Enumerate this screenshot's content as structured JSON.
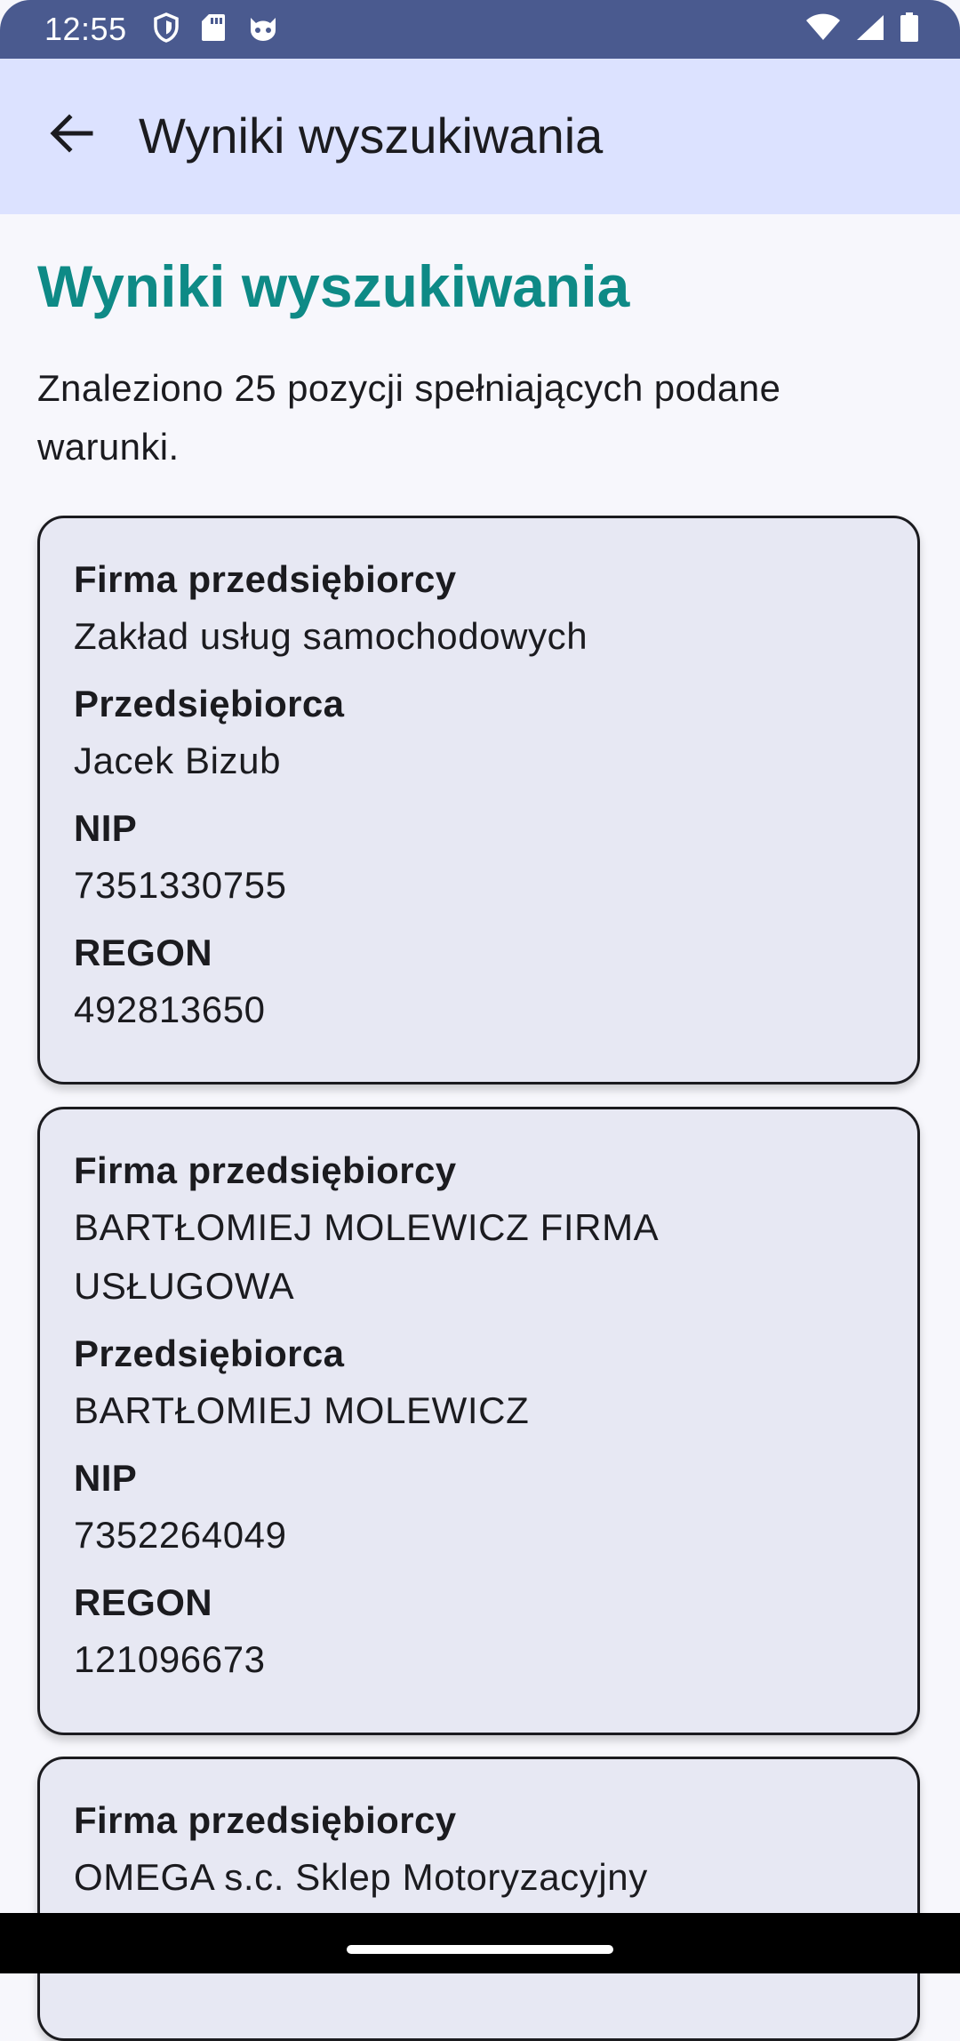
{
  "status_bar": {
    "time": "12:55",
    "left_icons": [
      "shield-icon",
      "sd-card-icon",
      "cat-notification-icon"
    ],
    "right_icons": [
      "wifi-icon",
      "cellular-signal-icon",
      "battery-icon"
    ]
  },
  "app_bar": {
    "title": "Wyniki wyszukiwania",
    "back_icon": "arrow-back-icon"
  },
  "main": {
    "heading": "Wyniki wyszukiwania",
    "summary": "Znaleziono 25 pozycji spełniających podane warunki.",
    "results": [
      {
        "firm_label": "Firma przedsiębiorcy",
        "firm_value": "Zakład usług samochodowych",
        "entrepreneur_label": "Przedsiębiorca",
        "entrepreneur_value": "Jacek Bizub",
        "nip_label": "NIP",
        "nip_value": "7351330755",
        "regon_label": "REGON",
        "regon_value": "492813650"
      },
      {
        "firm_label": "Firma przedsiębiorcy",
        "firm_value": "BARTŁOMIEJ MOLEWICZ FIRMA USŁUGOWA",
        "entrepreneur_label": "Przedsiębiorca",
        "entrepreneur_value": "BARTŁOMIEJ MOLEWICZ",
        "nip_label": "NIP",
        "nip_value": "7352264049",
        "regon_label": "REGON",
        "regon_value": "121096673"
      },
      {
        "firm_label": "Firma przedsiębiorcy",
        "firm_value": "OMEGA s.c. Sklep Motoryzacyjny"
      }
    ]
  },
  "colors": {
    "status_bar": "#4a5a8f",
    "app_bar": "#dce2ff",
    "heading": "#0e8a86",
    "card_background": "#e7e8f3",
    "page_background": "#f7f7fc"
  }
}
